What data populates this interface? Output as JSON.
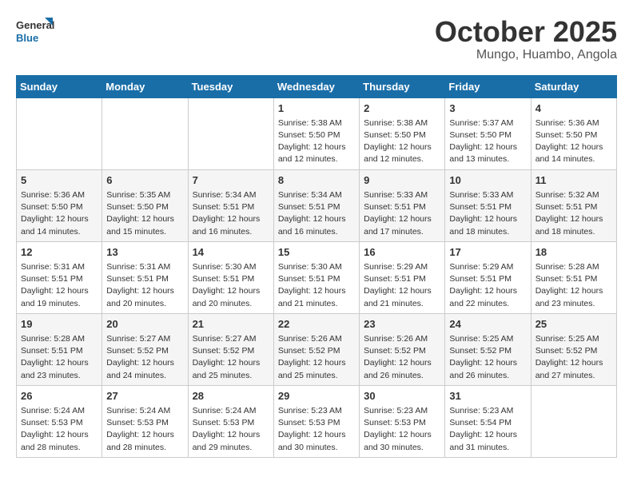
{
  "logo": {
    "line1": "General",
    "line2": "Blue"
  },
  "title": "October 2025",
  "location": "Mungo, Huambo, Angola",
  "days_of_week": [
    "Sunday",
    "Monday",
    "Tuesday",
    "Wednesday",
    "Thursday",
    "Friday",
    "Saturday"
  ],
  "weeks": [
    [
      {
        "day": "",
        "info": ""
      },
      {
        "day": "",
        "info": ""
      },
      {
        "day": "",
        "info": ""
      },
      {
        "day": "1",
        "info": "Sunrise: 5:38 AM\nSunset: 5:50 PM\nDaylight: 12 hours\nand 12 minutes."
      },
      {
        "day": "2",
        "info": "Sunrise: 5:38 AM\nSunset: 5:50 PM\nDaylight: 12 hours\nand 12 minutes."
      },
      {
        "day": "3",
        "info": "Sunrise: 5:37 AM\nSunset: 5:50 PM\nDaylight: 12 hours\nand 13 minutes."
      },
      {
        "day": "4",
        "info": "Sunrise: 5:36 AM\nSunset: 5:50 PM\nDaylight: 12 hours\nand 14 minutes."
      }
    ],
    [
      {
        "day": "5",
        "info": "Sunrise: 5:36 AM\nSunset: 5:50 PM\nDaylight: 12 hours\nand 14 minutes."
      },
      {
        "day": "6",
        "info": "Sunrise: 5:35 AM\nSunset: 5:50 PM\nDaylight: 12 hours\nand 15 minutes."
      },
      {
        "day": "7",
        "info": "Sunrise: 5:34 AM\nSunset: 5:51 PM\nDaylight: 12 hours\nand 16 minutes."
      },
      {
        "day": "8",
        "info": "Sunrise: 5:34 AM\nSunset: 5:51 PM\nDaylight: 12 hours\nand 16 minutes."
      },
      {
        "day": "9",
        "info": "Sunrise: 5:33 AM\nSunset: 5:51 PM\nDaylight: 12 hours\nand 17 minutes."
      },
      {
        "day": "10",
        "info": "Sunrise: 5:33 AM\nSunset: 5:51 PM\nDaylight: 12 hours\nand 18 minutes."
      },
      {
        "day": "11",
        "info": "Sunrise: 5:32 AM\nSunset: 5:51 PM\nDaylight: 12 hours\nand 18 minutes."
      }
    ],
    [
      {
        "day": "12",
        "info": "Sunrise: 5:31 AM\nSunset: 5:51 PM\nDaylight: 12 hours\nand 19 minutes."
      },
      {
        "day": "13",
        "info": "Sunrise: 5:31 AM\nSunset: 5:51 PM\nDaylight: 12 hours\nand 20 minutes."
      },
      {
        "day": "14",
        "info": "Sunrise: 5:30 AM\nSunset: 5:51 PM\nDaylight: 12 hours\nand 20 minutes."
      },
      {
        "day": "15",
        "info": "Sunrise: 5:30 AM\nSunset: 5:51 PM\nDaylight: 12 hours\nand 21 minutes."
      },
      {
        "day": "16",
        "info": "Sunrise: 5:29 AM\nSunset: 5:51 PM\nDaylight: 12 hours\nand 21 minutes."
      },
      {
        "day": "17",
        "info": "Sunrise: 5:29 AM\nSunset: 5:51 PM\nDaylight: 12 hours\nand 22 minutes."
      },
      {
        "day": "18",
        "info": "Sunrise: 5:28 AM\nSunset: 5:51 PM\nDaylight: 12 hours\nand 23 minutes."
      }
    ],
    [
      {
        "day": "19",
        "info": "Sunrise: 5:28 AM\nSunset: 5:51 PM\nDaylight: 12 hours\nand 23 minutes."
      },
      {
        "day": "20",
        "info": "Sunrise: 5:27 AM\nSunset: 5:52 PM\nDaylight: 12 hours\nand 24 minutes."
      },
      {
        "day": "21",
        "info": "Sunrise: 5:27 AM\nSunset: 5:52 PM\nDaylight: 12 hours\nand 25 minutes."
      },
      {
        "day": "22",
        "info": "Sunrise: 5:26 AM\nSunset: 5:52 PM\nDaylight: 12 hours\nand 25 minutes."
      },
      {
        "day": "23",
        "info": "Sunrise: 5:26 AM\nSunset: 5:52 PM\nDaylight: 12 hours\nand 26 minutes."
      },
      {
        "day": "24",
        "info": "Sunrise: 5:25 AM\nSunset: 5:52 PM\nDaylight: 12 hours\nand 26 minutes."
      },
      {
        "day": "25",
        "info": "Sunrise: 5:25 AM\nSunset: 5:52 PM\nDaylight: 12 hours\nand 27 minutes."
      }
    ],
    [
      {
        "day": "26",
        "info": "Sunrise: 5:24 AM\nSunset: 5:53 PM\nDaylight: 12 hours\nand 28 minutes."
      },
      {
        "day": "27",
        "info": "Sunrise: 5:24 AM\nSunset: 5:53 PM\nDaylight: 12 hours\nand 28 minutes."
      },
      {
        "day": "28",
        "info": "Sunrise: 5:24 AM\nSunset: 5:53 PM\nDaylight: 12 hours\nand 29 minutes."
      },
      {
        "day": "29",
        "info": "Sunrise: 5:23 AM\nSunset: 5:53 PM\nDaylight: 12 hours\nand 30 minutes."
      },
      {
        "day": "30",
        "info": "Sunrise: 5:23 AM\nSunset: 5:53 PM\nDaylight: 12 hours\nand 30 minutes."
      },
      {
        "day": "31",
        "info": "Sunrise: 5:23 AM\nSunset: 5:54 PM\nDaylight: 12 hours\nand 31 minutes."
      },
      {
        "day": "",
        "info": ""
      }
    ]
  ]
}
